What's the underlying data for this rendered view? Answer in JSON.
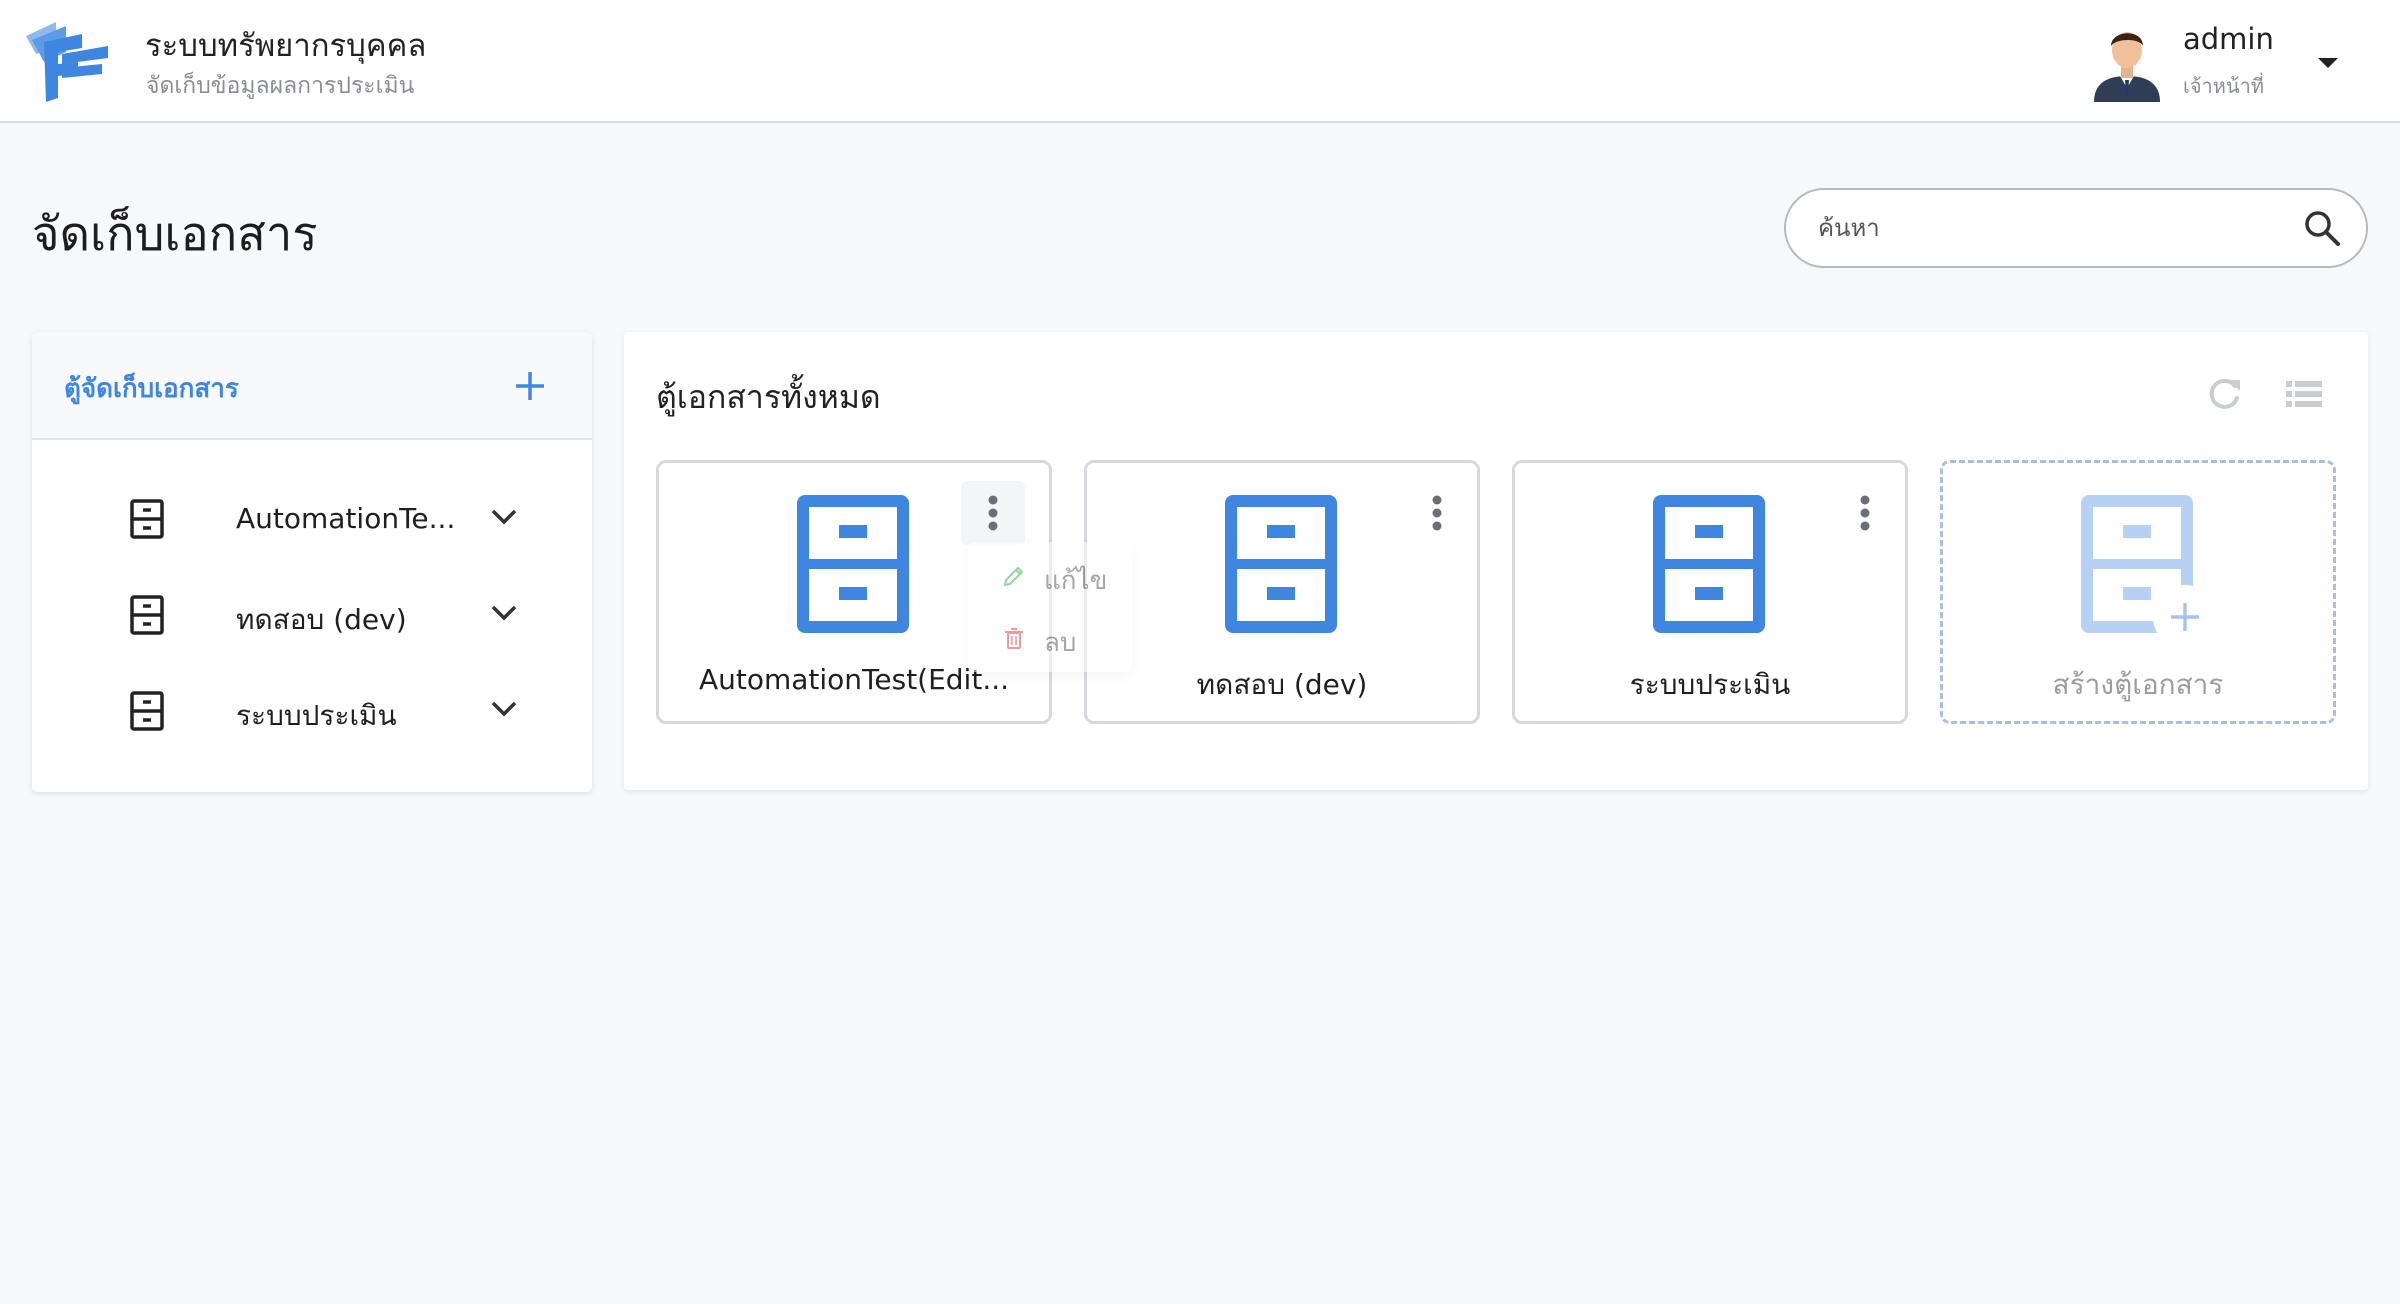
{
  "header": {
    "app_title": "ระบบทรัพยากรบุคคล",
    "app_subtitle": "จัดเก็บข้อมูลผลการประเมิน",
    "user_name": "admin",
    "user_role": "เจ้าหน้าที่"
  },
  "page": {
    "title": "จัดเก็บเอกสาร"
  },
  "search": {
    "placeholder": "ค้นหา",
    "value": ""
  },
  "sidebar": {
    "title": "ตู้จัดเก็บเอกสาร",
    "items": [
      {
        "label": "AutomationTe..."
      },
      {
        "label": "ทดสอบ (dev)"
      },
      {
        "label": "ระบบประเมิน"
      }
    ]
  },
  "main": {
    "title": "ตู้เอกสารทั้งหมด",
    "cards": [
      {
        "label": "AutomationTest(Edit..."
      },
      {
        "label": "ทดสอบ (dev)"
      },
      {
        "label": "ระบบประเมิน"
      }
    ],
    "create_label": "สร้างตู้เอกสาร"
  },
  "context_menu": {
    "edit_label": "แก้ไข",
    "delete_label": "ลบ"
  },
  "colors": {
    "accent": "#3f86e0",
    "cabinet_blue": "#3f86e0",
    "cabinet_faded": "#b7d1f5",
    "background": "#f7f8fa"
  },
  "icons": {
    "logo": "hr-logo-icon",
    "search": "search-icon",
    "add": "plus-icon",
    "cabinet": "file-cabinet-icon",
    "chevron": "chevron-down-icon",
    "refresh": "refresh-icon",
    "list": "list-view-icon",
    "kebab": "more-vertical-icon",
    "edit": "pencil-icon",
    "delete": "trash-icon"
  }
}
